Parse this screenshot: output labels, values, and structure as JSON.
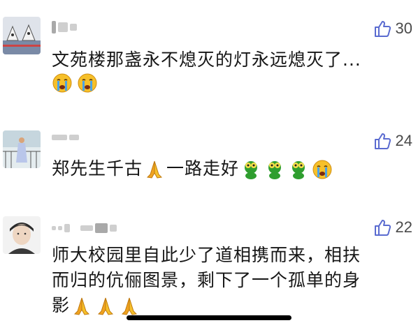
{
  "comments": [
    {
      "text": "文苑楼那盏永不熄灭的灯永远熄灭了...",
      "likes": "30",
      "emojis": [
        "crying-face",
        "crying-face"
      ]
    },
    {
      "text": "郑先生千古",
      "text_after": "一路走好",
      "likes": "24",
      "emojis": [
        "pray-hands",
        "green-frog",
        "green-frog",
        "green-frog",
        "crying-face"
      ]
    },
    {
      "line1": "师大校园里自此少了道相携而来，相扶",
      "line2": "而归的伉俪图景，剩下了一个孤单的身",
      "line3": "影",
      "likes": "22",
      "emojis": [
        "pray-hands",
        "pray-hands",
        "pray-hands"
      ]
    }
  ],
  "colors": {
    "like_icon": "#5a6bd0",
    "emoji_yellow": "#f6c02a",
    "frog_green": "#2f9e2f",
    "tears": "#4aa3e8",
    "hands": "#f0a320"
  }
}
